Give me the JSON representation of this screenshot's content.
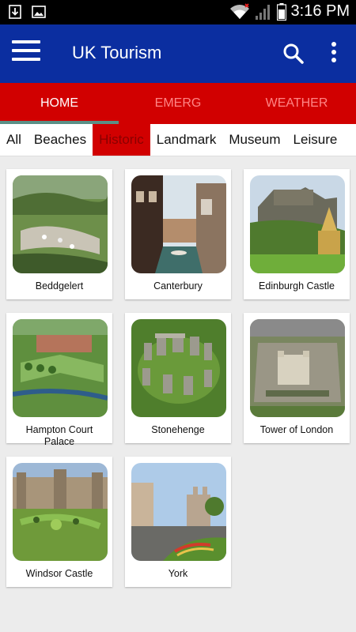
{
  "status_bar": {
    "time": "3:16 PM",
    "icons": [
      "download-icon",
      "image-icon",
      "wifi-icon",
      "signal-icon",
      "battery-icon"
    ]
  },
  "app_bar": {
    "title": "UK Tourism",
    "menu_icon": "hamburger-menu-icon",
    "search_icon": "search-icon",
    "more_icon": "more-vert-icon",
    "color": "#0b2ea0"
  },
  "tabs": [
    {
      "label": "HOME",
      "active": true
    },
    {
      "label": "EMERG",
      "active": false
    },
    {
      "label": "WEATHER",
      "active": false
    }
  ],
  "tab_color": "#d10000",
  "categories": [
    {
      "label": "All"
    },
    {
      "label": "Beaches"
    },
    {
      "label": "Historic",
      "active": true
    },
    {
      "label": "Landmark"
    },
    {
      "label": "Museum"
    },
    {
      "label": "Leisure"
    }
  ],
  "places": [
    {
      "name": "Beddgelert"
    },
    {
      "name": "Canterbury"
    },
    {
      "name": "Edinburgh Castle"
    },
    {
      "name": "Hampton Court Palace"
    },
    {
      "name": "Stonehenge"
    },
    {
      "name": "Tower of London"
    },
    {
      "name": "Windsor Castle"
    },
    {
      "name": "York"
    }
  ]
}
